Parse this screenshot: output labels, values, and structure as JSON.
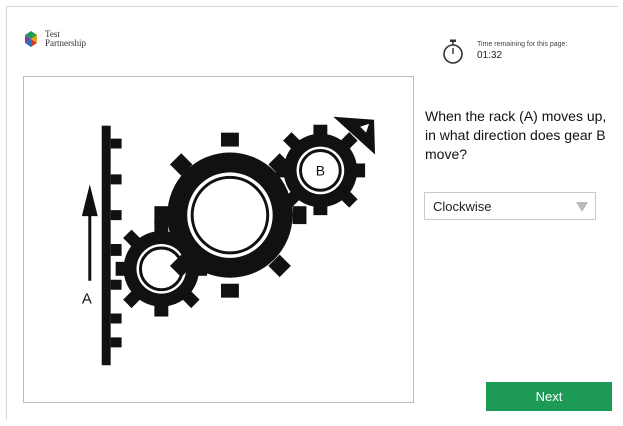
{
  "brand": {
    "line1": "Test",
    "line2": "Partnership"
  },
  "timer": {
    "label": "Time remaining for this page:",
    "value": "01:32",
    "icon": "stopwatch-icon"
  },
  "diagram": {
    "label_rack": "A",
    "label_gear": "B"
  },
  "question": {
    "text": "When the rack (A) moves up, in what direction does gear B move?"
  },
  "answer_select": {
    "selected": "Clockwise"
  },
  "buttons": {
    "next": "Next"
  },
  "colors": {
    "next_button": "#1e9a57",
    "diagram_ink": "#111111"
  }
}
